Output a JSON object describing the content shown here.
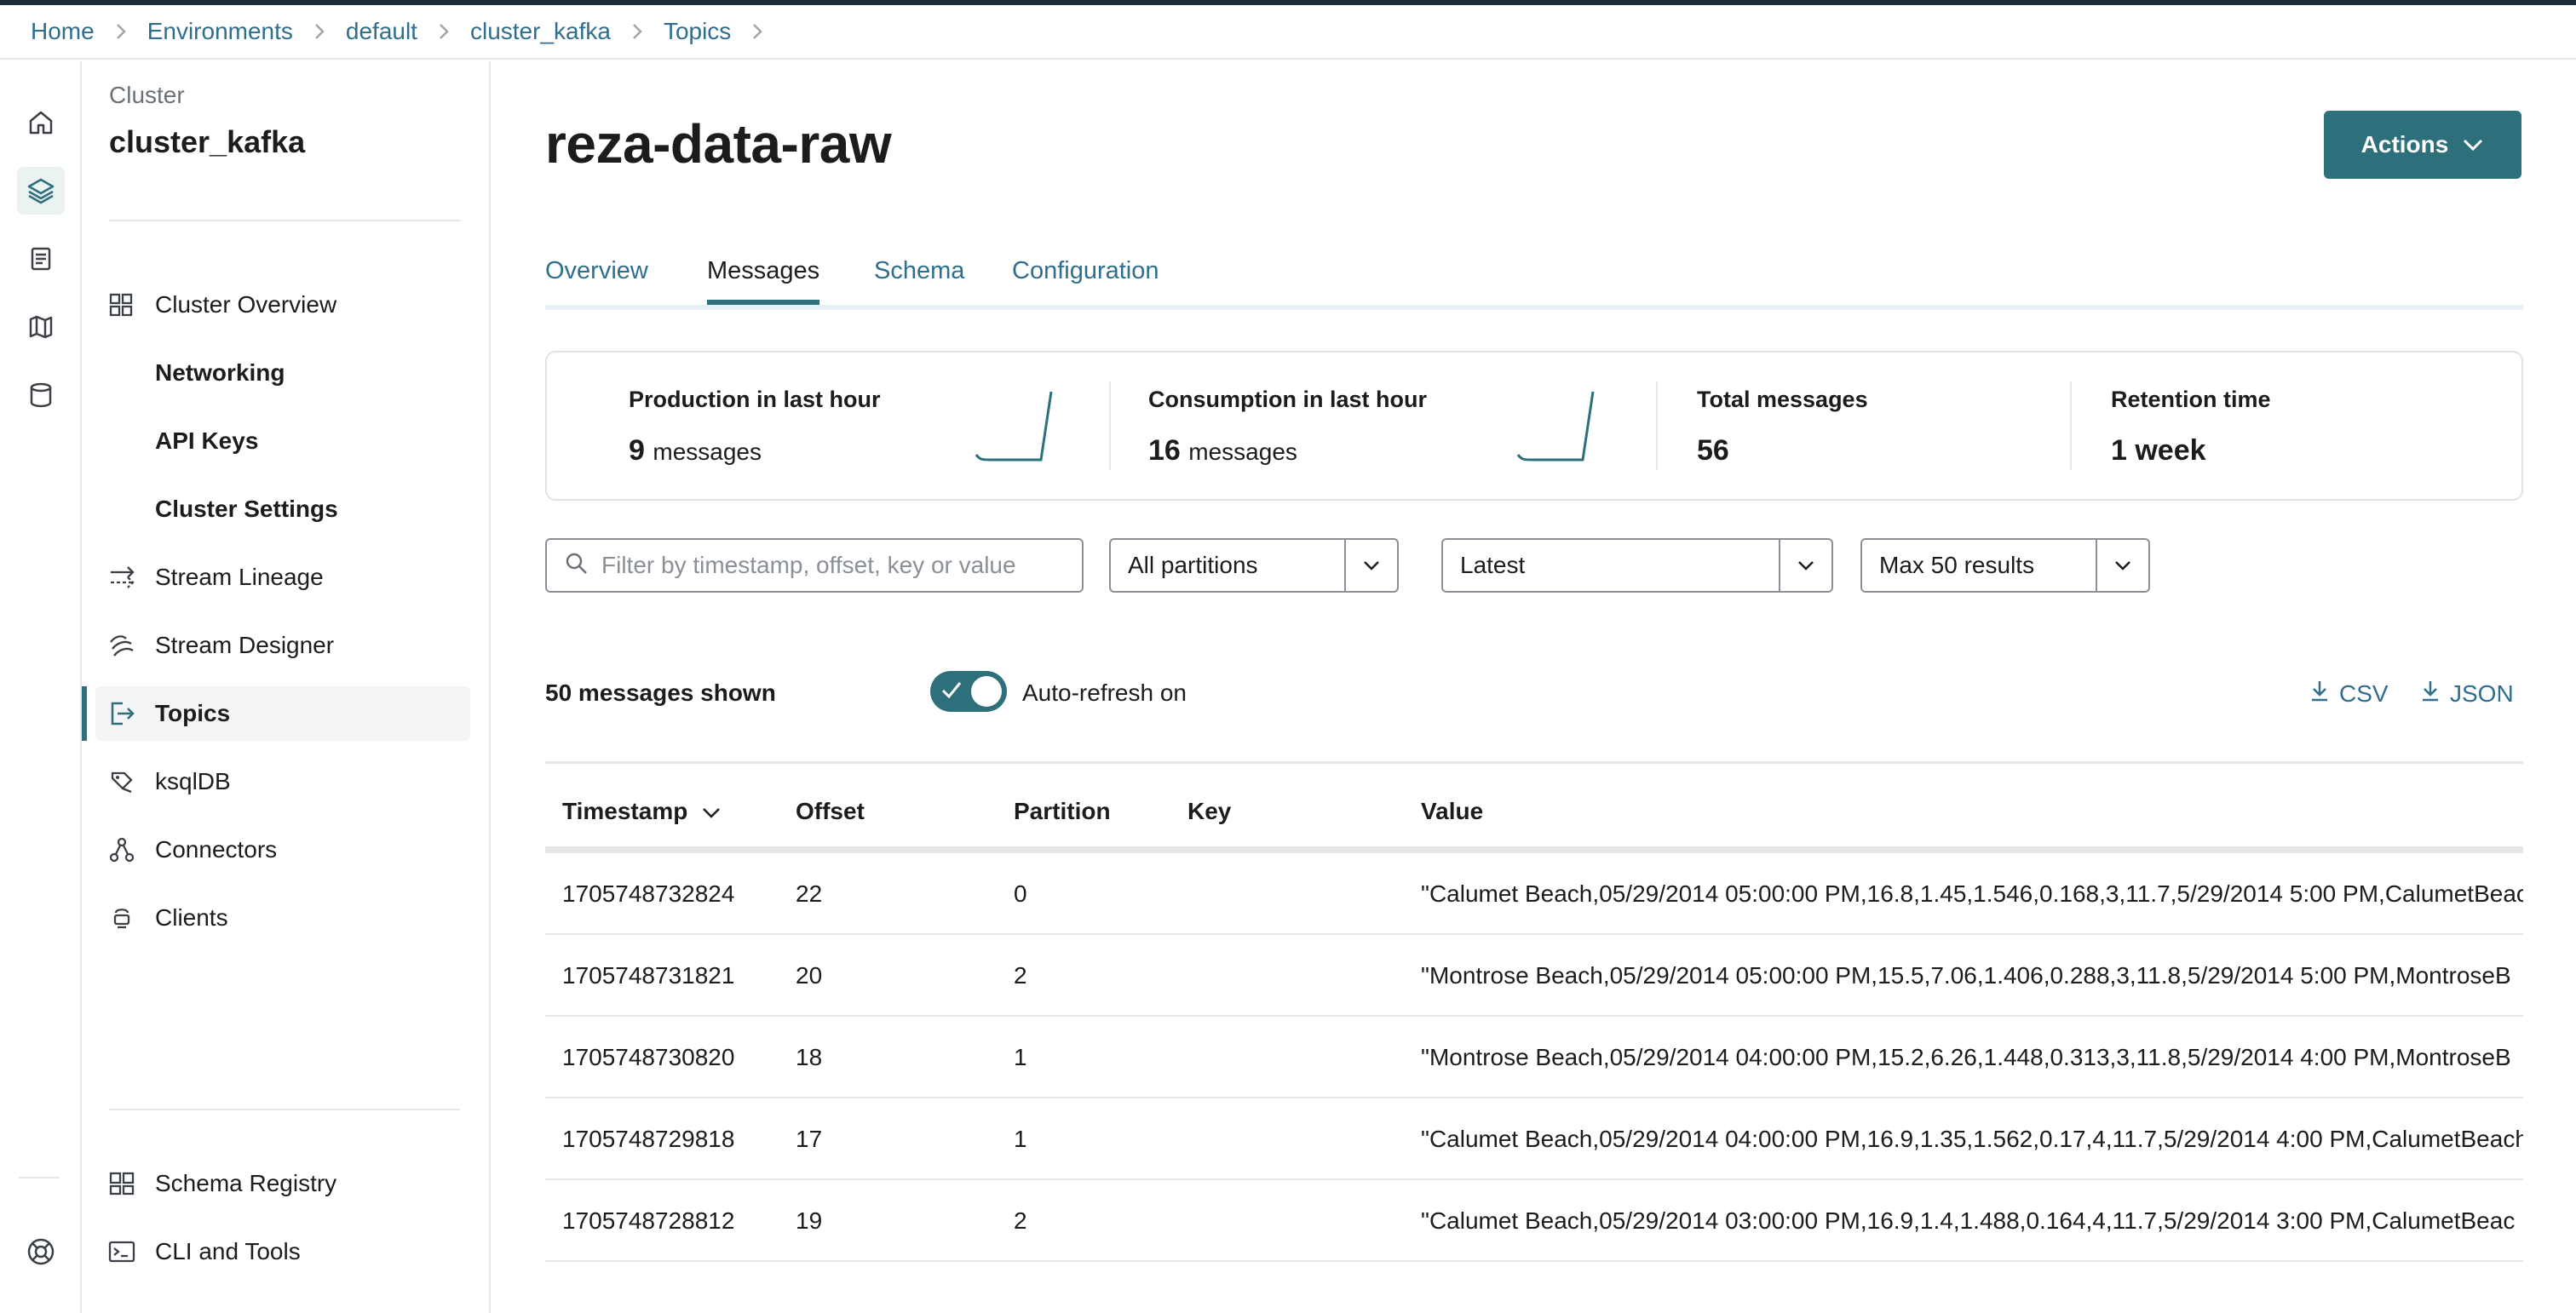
{
  "breadcrumb": {
    "items": [
      "Home",
      "Environments",
      "default",
      "cluster_kafka",
      "Topics"
    ]
  },
  "rail": {
    "icons": [
      "home-icon",
      "layers-icon",
      "document-icon",
      "map-icon",
      "database-icon",
      "help-icon"
    ],
    "active": "layers-icon"
  },
  "sidebar": {
    "cluster_label": "Cluster",
    "cluster_name": "cluster_kafka",
    "items": [
      {
        "label": "Cluster Overview",
        "icon": "grid-icon"
      },
      {
        "label": "Networking"
      },
      {
        "label": "API Keys"
      },
      {
        "label": "Cluster Settings"
      },
      {
        "label": "Stream Lineage",
        "icon": "lineage-icon"
      },
      {
        "label": "Stream Designer",
        "icon": "designer-icon"
      },
      {
        "label": "Topics",
        "icon": "topic-icon",
        "active": true
      },
      {
        "label": "ksqlDB",
        "icon": "ksqldb-icon"
      },
      {
        "label": "Connectors",
        "icon": "connectors-icon"
      },
      {
        "label": "Clients",
        "icon": "clients-icon"
      }
    ],
    "bottom_items": [
      {
        "label": "Schema Registry",
        "icon": "schema-icon"
      },
      {
        "label": "CLI and Tools",
        "icon": "terminal-icon"
      }
    ]
  },
  "page": {
    "title": "reza-data-raw",
    "actions_label": "Actions"
  },
  "tabs": [
    {
      "label": "Overview"
    },
    {
      "label": "Messages",
      "active": true
    },
    {
      "label": "Schema"
    },
    {
      "label": "Configuration"
    }
  ],
  "stats": {
    "production": {
      "label": "Production in last hour",
      "value": "9",
      "unit": "messages"
    },
    "consumption": {
      "label": "Consumption in last hour",
      "value": "16",
      "unit": "messages"
    },
    "total": {
      "label": "Total messages",
      "value": "56"
    },
    "retention": {
      "label": "Retention time",
      "value": "1 week"
    }
  },
  "filters": {
    "search_placeholder": "Filter by timestamp, offset, key or value",
    "partition": "All partitions",
    "offset": "Latest",
    "limit": "Max 50 results"
  },
  "messages": {
    "count_label": "50 messages shown",
    "auto_refresh_label": "Auto-refresh on",
    "auto_refresh": true,
    "csv_label": "CSV",
    "json_label": "JSON",
    "columns": [
      "Timestamp",
      "Offset",
      "Partition",
      "Key",
      "Value"
    ],
    "rows": [
      {
        "timestamp": "1705748732824",
        "offset": "22",
        "partition": "0",
        "key": "",
        "value": "\"Calumet Beach,05/29/2014 05:00:00 PM,16.8,1.45,1.546,0.168,3,11.7,5/29/2014 5:00 PM,CalumetBeac"
      },
      {
        "timestamp": "1705748731821",
        "offset": "20",
        "partition": "2",
        "key": "",
        "value": "\"Montrose Beach,05/29/2014 05:00:00 PM,15.5,7.06,1.406,0.288,3,11.8,5/29/2014 5:00 PM,MontroseB"
      },
      {
        "timestamp": "1705748730820",
        "offset": "18",
        "partition": "1",
        "key": "",
        "value": "\"Montrose Beach,05/29/2014 04:00:00 PM,15.2,6.26,1.448,0.313,3,11.8,5/29/2014 4:00 PM,MontroseB"
      },
      {
        "timestamp": "1705748729818",
        "offset": "17",
        "partition": "1",
        "key": "",
        "value": "\"Calumet Beach,05/29/2014 04:00:00 PM,16.9,1.35,1.562,0.17,4,11.7,5/29/2014 4:00 PM,CalumetBeach"
      },
      {
        "timestamp": "1705748728812",
        "offset": "19",
        "partition": "2",
        "key": "",
        "value": "\"Calumet Beach,05/29/2014 03:00:00 PM,16.9,1.4,1.488,0.164,4,11.7,5/29/2014 3:00 PM,CalumetBeac"
      }
    ]
  },
  "colors": {
    "accent": "#2d6f7a",
    "link": "#2f6e8e",
    "border": "#e6e6e6"
  }
}
